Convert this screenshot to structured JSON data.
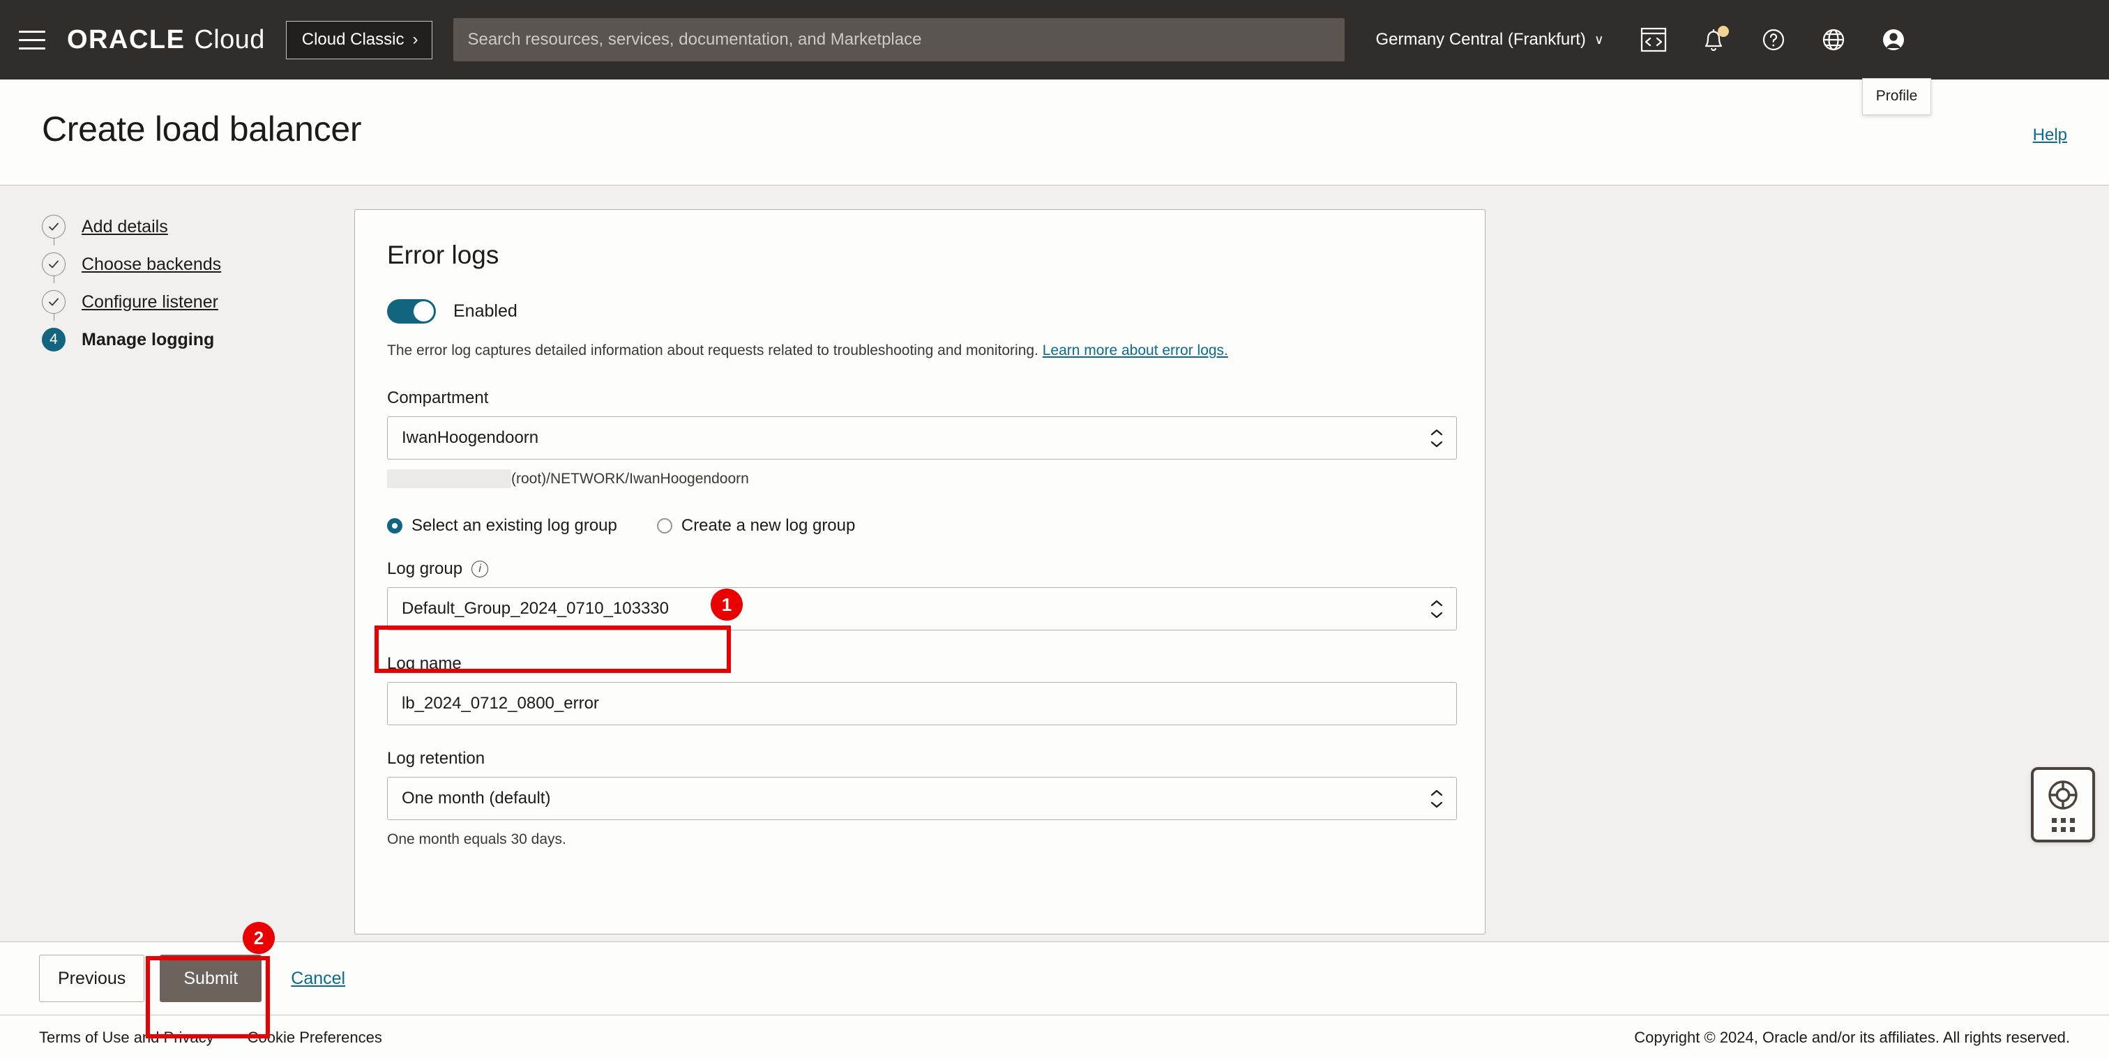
{
  "header": {
    "menu_icon": "hamburger-menu-icon",
    "brand_oracle": "ORACLE",
    "brand_cloud": "Cloud",
    "cloud_classic_label": "Cloud Classic",
    "cloud_classic_chevron": "›",
    "search_placeholder": "Search resources, services, documentation, and Marketplace",
    "search_value": "",
    "region_label": "Germany Central (Frankfurt)",
    "region_caret": "∨",
    "icons": [
      {
        "name": "cloud-shell-icon",
        "title": "Cloud Shell"
      },
      {
        "name": "notifications-bell-icon",
        "title": "Notifications"
      },
      {
        "name": "help-question-icon",
        "title": "Help"
      },
      {
        "name": "language-globe-icon",
        "title": "Language"
      },
      {
        "name": "profile-avatar-icon",
        "title": "Profile"
      }
    ],
    "profile_tooltip": "Profile"
  },
  "page": {
    "title": "Create load balancer",
    "help_link": "Help"
  },
  "steps": [
    {
      "label": "Add details",
      "state": "done",
      "marker": "✓"
    },
    {
      "label": "Choose backends",
      "state": "done",
      "marker": "✓"
    },
    {
      "label": "Configure listener",
      "state": "done",
      "marker": "✓"
    },
    {
      "label": "Manage logging",
      "state": "current",
      "marker": "4"
    }
  ],
  "card": {
    "section_title": "Error logs",
    "toggle": {
      "state_label": "Enabled",
      "enabled": true,
      "color": "#12657f"
    },
    "description": "The error log captures detailed information about requests related to troubleshooting and monitoring.",
    "description_link": "Learn more about error logs.",
    "compartment": {
      "label": "Compartment",
      "value": "IwanHoogendoorn",
      "path": "(root)/NETWORK/IwanHoogendoorn"
    },
    "log_group_mode": {
      "existing_label": "Select an existing log group",
      "new_label": "Create a new log group",
      "selected": "existing"
    },
    "log_group": {
      "label": "Log group",
      "info_icon": "info-icon",
      "value": "Default_Group_2024_0710_103330"
    },
    "log_name": {
      "label": "Log name",
      "value": "lb_2024_0712_0800_error"
    },
    "log_retention": {
      "label": "Log retention",
      "value": "One month (default)",
      "note": "One month equals 30 days."
    }
  },
  "annotations": [
    {
      "badge": "1",
      "target": "log-group-select"
    },
    {
      "badge": "2",
      "target": "submit-button"
    }
  ],
  "annotation_color": "#ea0000",
  "actions": {
    "previous": "Previous",
    "submit": "Submit",
    "cancel": "Cancel"
  },
  "help_widget": {
    "icon": "life-ring-support-icon",
    "grip": "drag-handle-dots-icon"
  },
  "footer": {
    "terms": "Terms of Use and Privacy",
    "cookies": "Cookie Preferences",
    "copyright": "Copyright © 2024, Oracle and/or its affiliates. All rights reserved."
  }
}
